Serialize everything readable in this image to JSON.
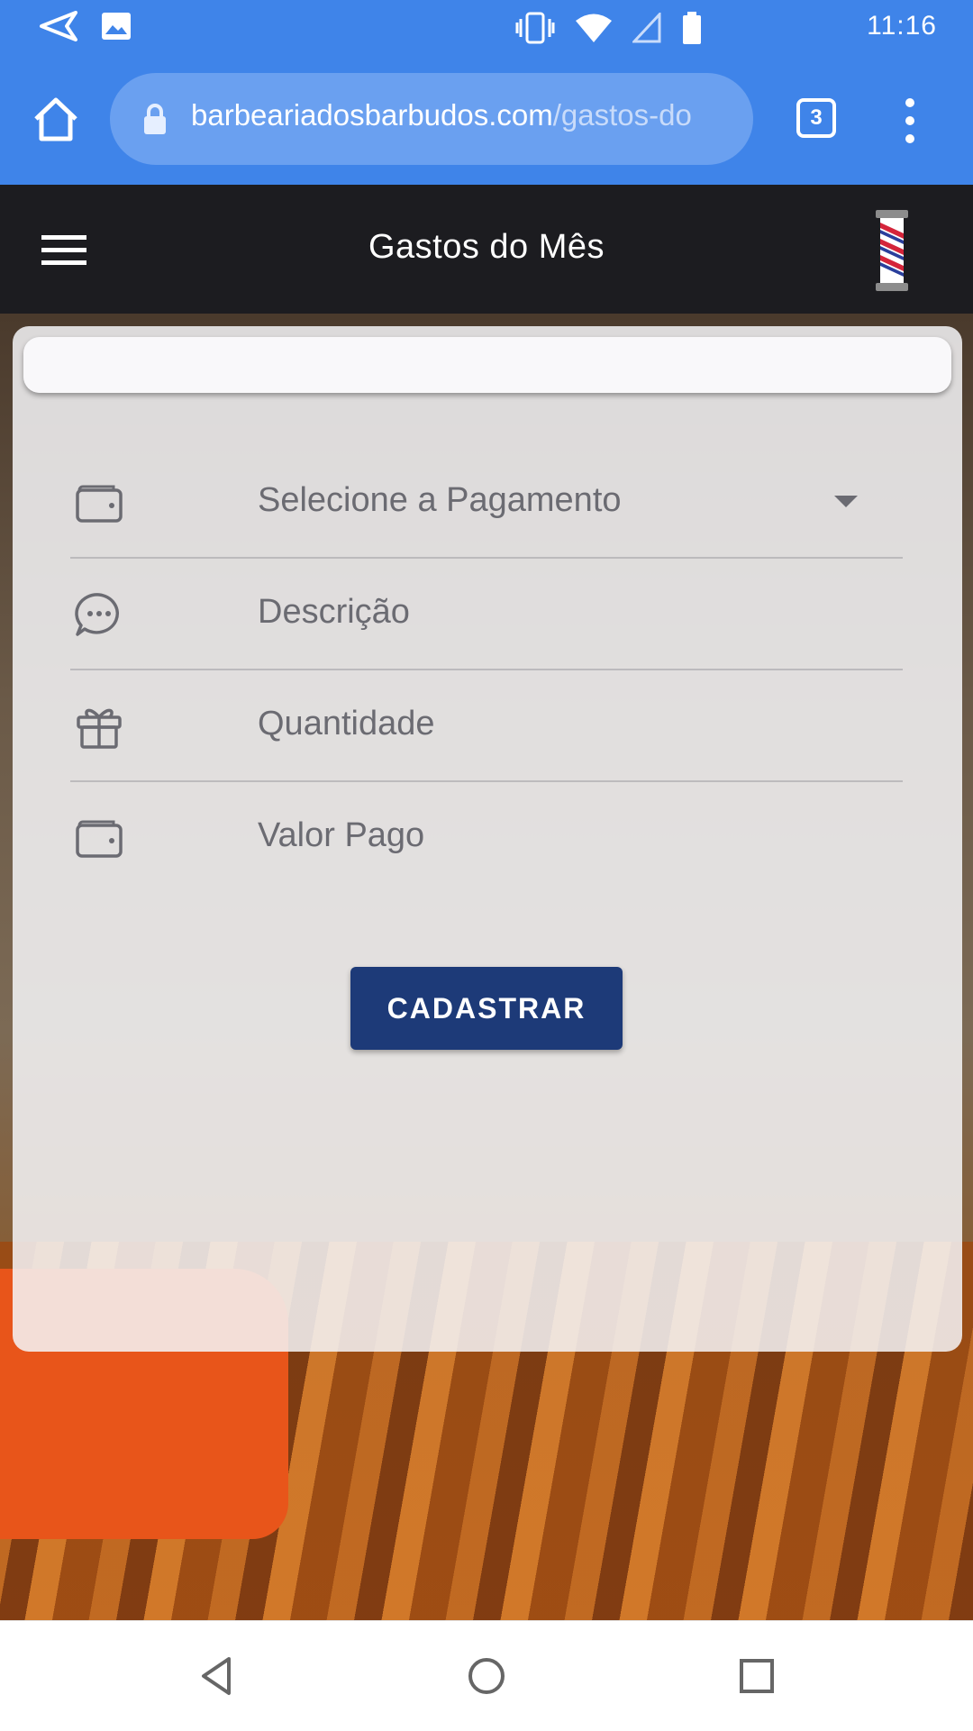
{
  "status_bar": {
    "time": "11:16",
    "icons": [
      "send-icon",
      "image-icon",
      "vibrate-icon",
      "wifi-icon",
      "signal-icon",
      "battery-icon"
    ]
  },
  "browser": {
    "url_domain": "barbeariadosbarbudos.com",
    "url_path": "/gastos-do",
    "tab_count": "3"
  },
  "app": {
    "title": "Gastos do Mês"
  },
  "form": {
    "fields": [
      {
        "icon": "wallet-icon",
        "placeholder": "Selecione a Pagamento",
        "type": "select"
      },
      {
        "icon": "chat-icon",
        "placeholder": "Descrição",
        "type": "text"
      },
      {
        "icon": "gift-icon",
        "placeholder": "Quantidade",
        "type": "text"
      },
      {
        "icon": "wallet-icon",
        "placeholder": "Valor Pago",
        "type": "text"
      }
    ],
    "submit_label": "CADASTRAR"
  },
  "colors": {
    "chrome_blue": "#3f84e9",
    "header_dark": "#1c1c20",
    "button_navy": "#1d3a78"
  }
}
